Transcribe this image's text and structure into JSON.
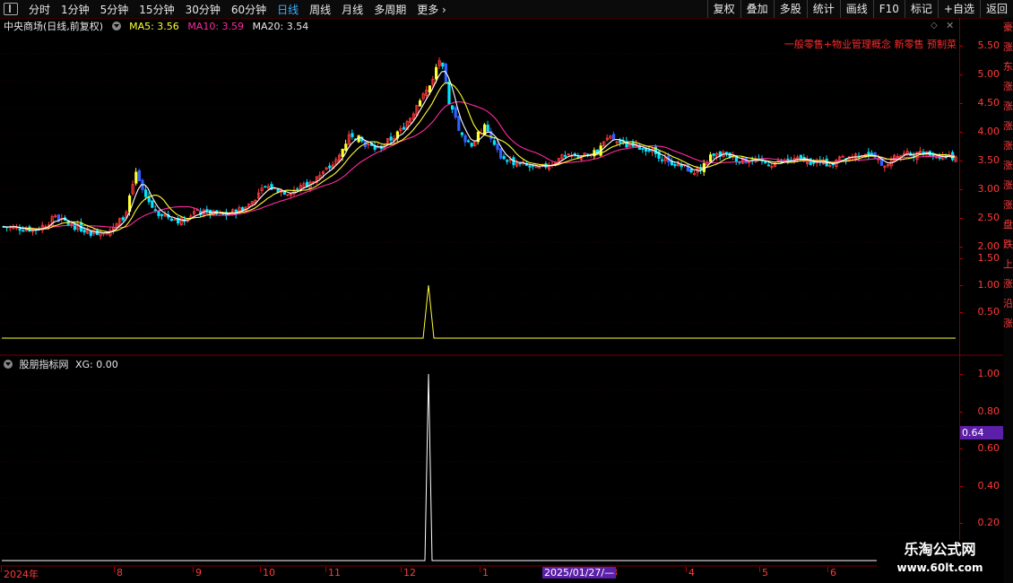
{
  "topbar": {
    "tabs": [
      "分时",
      "1分钟",
      "5分钟",
      "15分钟",
      "30分钟",
      "60分钟",
      "日线",
      "周线",
      "月线",
      "多周期",
      "更多"
    ],
    "active_tab": "日线",
    "right_buttons": [
      "复权",
      "叠加",
      "多股",
      "统计",
      "画线",
      "F10",
      "标记",
      "+自选",
      "返回"
    ]
  },
  "main_legend": {
    "title": "中央商场(日线,前复权)",
    "ma5": "MA5: 3.56",
    "ma10": "MA10: 3.59",
    "ma20": "MA20: 3.54"
  },
  "concept_text": "一般零售+物业管理概念 新零售 预制菜",
  "indicator_legend": {
    "name": "股朋指标网",
    "xg": "XG: 0.00"
  },
  "price_axis": [
    "5.50",
    "5.00",
    "4.50",
    "4.00",
    "3.50",
    "3.00",
    "2.50",
    "2.00",
    "1.50",
    "1.00",
    "0.50"
  ],
  "indicator_axis": [
    "1.00",
    "0.80",
    "0.60",
    "0.40",
    "0.20"
  ],
  "indicator_badge": "0.64",
  "x_axis": [
    "2024年",
    "8",
    "9",
    "10",
    "11",
    "12",
    "1",
    "3",
    "4",
    "5",
    "6"
  ],
  "crosshair_date": "2025/01/27/—",
  "watermark": {
    "title": "乐淘公式网",
    "url": "www.60lt.com"
  },
  "sidebar_chars": "豪涨东涨涨涨涨涨涨涨盘跌上涨沿涨",
  "colors": {
    "up": "#ff3b3b",
    "down": "#00e5ff",
    "ma5": "#ffffff",
    "ma10": "#ffff33",
    "ma20": "#ff2aa0",
    "signal": "#ffff33",
    "indicator_badge": "#5c1fa8"
  },
  "chart_data": {
    "type": "candlestick",
    "price_range": [
      2.0,
      5.7
    ],
    "ma_values": {
      "MA5": 3.56,
      "MA10": 3.59,
      "MA20": 3.54
    },
    "close_trend_keypoints": [
      {
        "period": "2024年",
        "close": 2.35
      },
      {
        "period": "8",
        "close": 3.3
      },
      {
        "period": "9",
        "close": 2.5
      },
      {
        "period": "10",
        "close": 3.0
      },
      {
        "period": "11",
        "close": 3.6
      },
      {
        "period": "12",
        "close": 5.6
      },
      {
        "period": "1",
        "close": 3.9
      },
      {
        "period": "3",
        "close": 3.55
      },
      {
        "period": "4",
        "close": 3.25
      },
      {
        "period": "5",
        "close": 3.5
      },
      {
        "period": "6",
        "close": 3.55
      }
    ],
    "indicator": {
      "name": "XG",
      "range": [
        0,
        1.0
      ],
      "spike_value": 1.0,
      "spike_period": "12"
    }
  }
}
